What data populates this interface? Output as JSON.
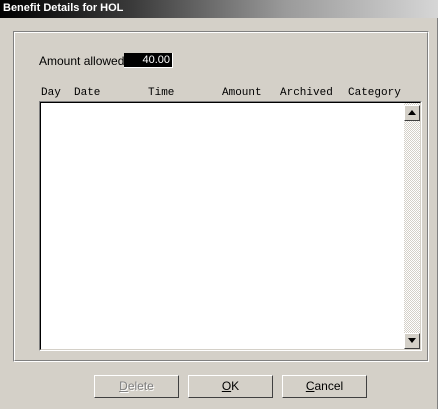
{
  "window": {
    "title": "Benefit Details for HOL"
  },
  "amount": {
    "label": "Amount allowed",
    "value": "40.00"
  },
  "list": {
    "columns": [
      "Day",
      "Date",
      "Time",
      "Amount",
      "Archived",
      "Category"
    ],
    "rows": []
  },
  "buttons": {
    "delete": {
      "accel": "D",
      "rest": "elete",
      "enabled": false
    },
    "ok": {
      "accel": "O",
      "rest": "K",
      "enabled": true
    },
    "cancel": {
      "accel": "C",
      "rest": "ancel",
      "enabled": true
    }
  },
  "colors": {
    "face": "#d4d0c8",
    "shadow": "#808080",
    "highlight": "#ffffff",
    "title_start": "#000000",
    "title_end": "#d6d6d6",
    "field_bg": "#000000",
    "field_text": "#ffffff"
  },
  "icons": {
    "scroll_up": "triangle-up-icon",
    "scroll_down": "triangle-down-icon"
  }
}
